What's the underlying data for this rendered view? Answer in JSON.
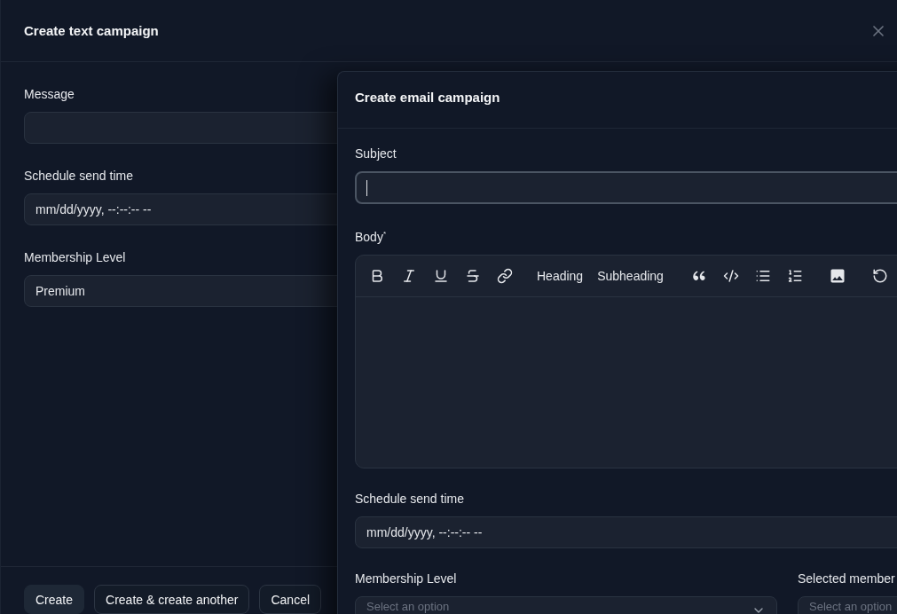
{
  "text_campaign": {
    "title": "Create text campaign",
    "message": {
      "label": "Message"
    },
    "schedule": {
      "label": "Schedule send time",
      "placeholder": "mm/dd/yyyy, --:--:-- --"
    },
    "membership_level": {
      "label": "Membership Level",
      "value": "Premium"
    },
    "buttons": [
      {
        "label": "Create",
        "kind": "primary"
      },
      {
        "label": "Create & create another",
        "kind": "secondary"
      },
      {
        "label": "Cancel",
        "kind": "secondary"
      }
    ]
  },
  "email_campaign": {
    "title": "Create email campaign",
    "subject": {
      "label": "Subject",
      "focused": true
    },
    "body": {
      "label": "Body$^{*}$",
      "heading_button": "Heading",
      "subheading_button": "Subheading"
    },
    "schedule": {
      "label": "Schedule send time",
      "placeholder": "mm/dd/yyyy, --:--:-- --"
    },
    "membership_level": {
      "label": "Membership Level",
      "placeholder": "Select an option"
    },
    "selected_member": {
      "label": "Selected member",
      "placeholder": "Select an option"
    }
  }
}
